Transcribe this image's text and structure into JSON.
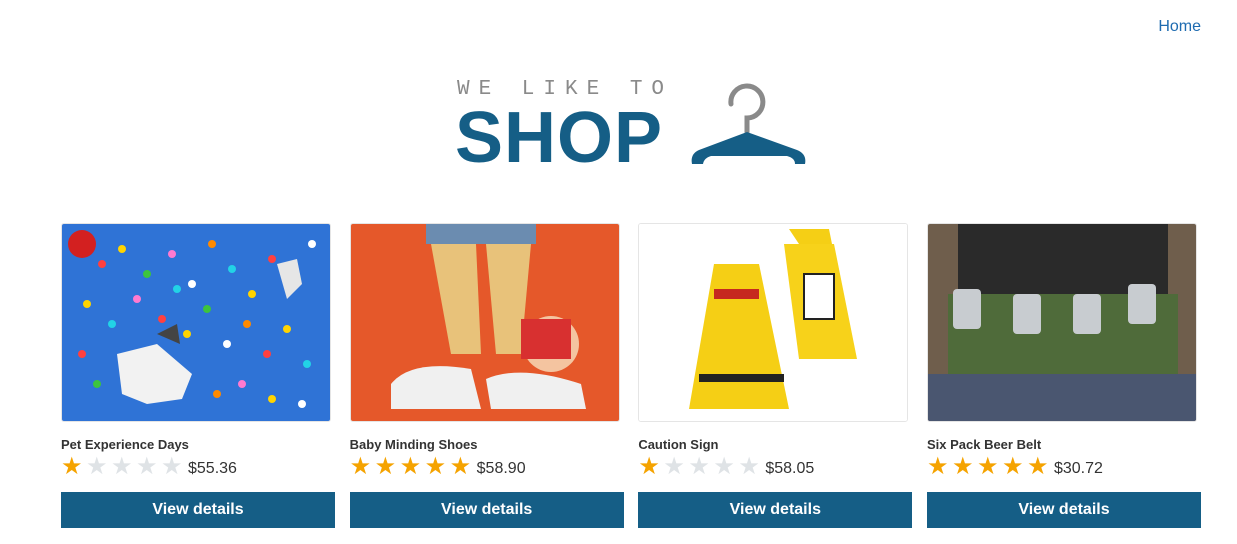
{
  "nav": {
    "home_label": "Home"
  },
  "logo": {
    "tagline": "WE LIKE TO",
    "word": "SHOP",
    "icon": "hanger-icon"
  },
  "colors": {
    "brand": "#155e86",
    "link": "#1e6bb0",
    "star_on": "#f5a300",
    "star_off": "#dfe3e6"
  },
  "products": [
    {
      "title": "Pet Experience Days",
      "rating": 1,
      "max_rating": 5,
      "price": "$55.36",
      "button": "View details"
    },
    {
      "title": "Baby Minding Shoes",
      "rating": 5,
      "max_rating": 5,
      "price": "$58.90",
      "button": "View details"
    },
    {
      "title": "Caution Sign",
      "rating": 1,
      "max_rating": 5,
      "price": "$58.05",
      "button": "View details"
    },
    {
      "title": "Six Pack Beer Belt",
      "rating": 5,
      "max_rating": 5,
      "price": "$30.72",
      "button": "View details"
    }
  ]
}
